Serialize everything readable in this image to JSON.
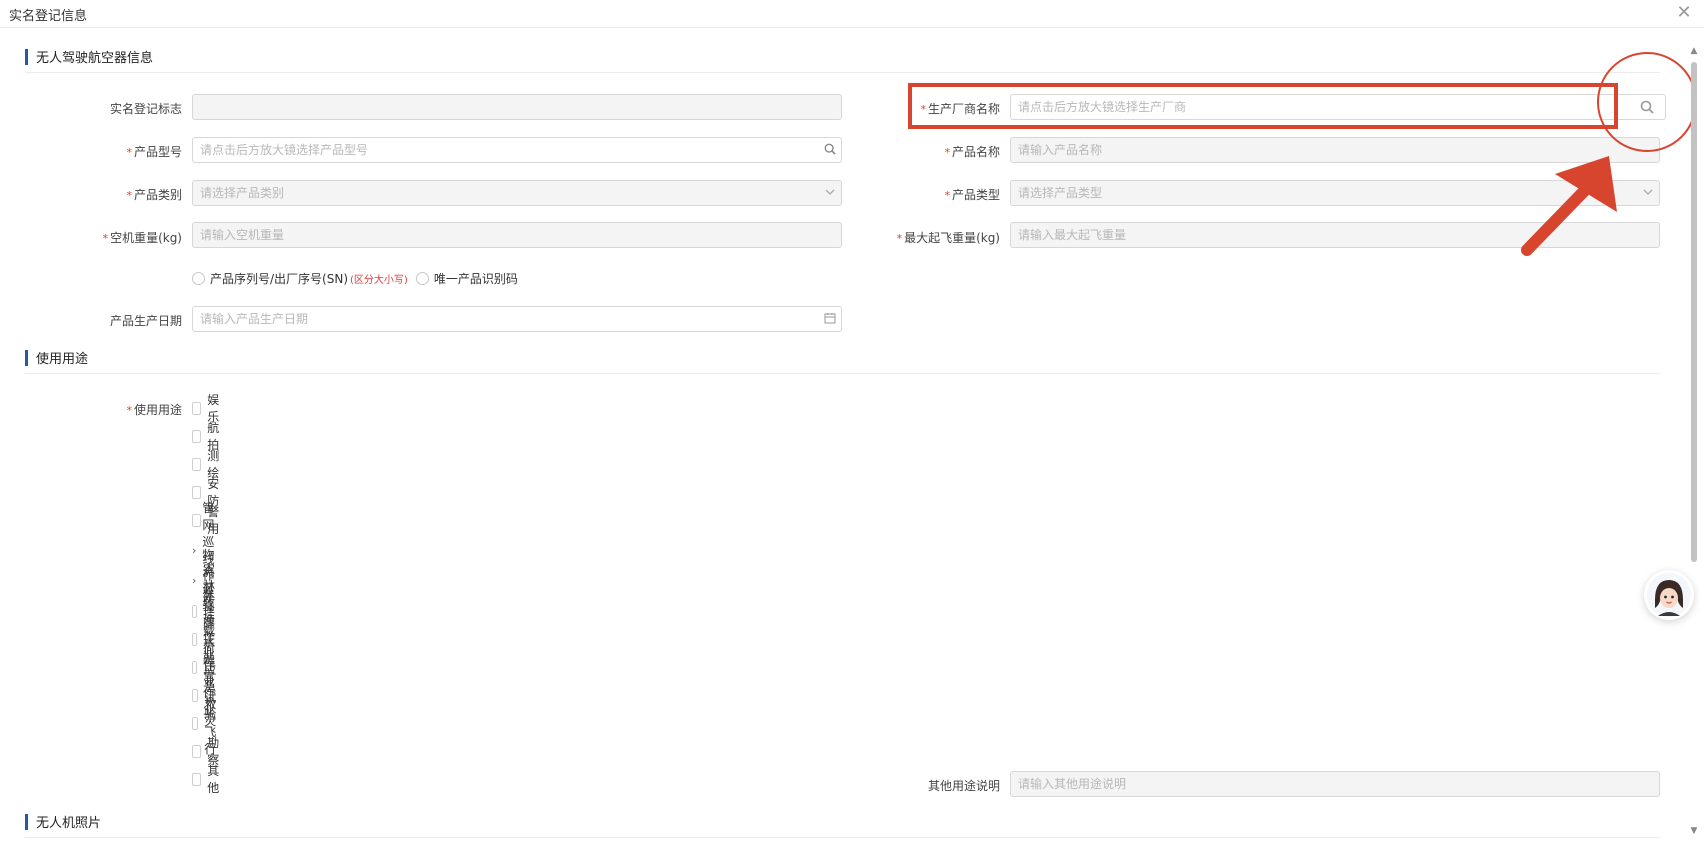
{
  "window": {
    "title": "实名登记信息"
  },
  "sections": {
    "aircraft": "无人驾驶航空器信息",
    "usage": "使用用途",
    "photos": "无人机照片"
  },
  "form": {
    "reg_mark": {
      "label": "实名登记标志",
      "placeholder": ""
    },
    "manufacturer": {
      "label": "生产厂商名称",
      "placeholder": "请点击后方放大镜选择生产厂商"
    },
    "model": {
      "label": "产品型号",
      "placeholder": "请点击后方放大镜选择产品型号"
    },
    "product_name": {
      "label": "产品名称",
      "placeholder": "请输入产品名称"
    },
    "category": {
      "label": "产品类别",
      "placeholder": "请选择产品类别"
    },
    "product_type": {
      "label": "产品类型",
      "placeholder": "请选择产品类型"
    },
    "empty_weight": {
      "label": "空机重量(kg)",
      "placeholder": "请输入空机重量"
    },
    "max_takeoff": {
      "label": "最大起飞重量(kg)",
      "placeholder": "请输入最大起飞重量"
    },
    "serial_option": {
      "label": "产品序列号/出厂序号(SN)",
      "note": "(区分大小写)"
    },
    "uid_option": {
      "label": "唯一产品识别码"
    },
    "production_date": {
      "label": "产品生产日期",
      "placeholder": "请输入产品生产日期"
    }
  },
  "usage": {
    "label": "使用用途",
    "items": [
      {
        "type": "checkbox",
        "label": "娱乐"
      },
      {
        "type": "checkbox",
        "label": "航拍"
      },
      {
        "type": "checkbox",
        "label": "测绘"
      },
      {
        "type": "checkbox",
        "label": "安防"
      },
      {
        "type": "checkbox",
        "label": "警用"
      },
      {
        "type": "group",
        "label": "管网巡线作业"
      },
      {
        "type": "group",
        "label": "物流运输"
      },
      {
        "type": "checkbox",
        "label": "农林牧渔作业"
      },
      {
        "type": "checkbox",
        "label": "外挂载荷作业"
      },
      {
        "type": "checkbox",
        "label": "降水融雪作业"
      },
      {
        "type": "checkbox",
        "label": "应急救灾"
      },
      {
        "type": "checkbox",
        "label": "试验飞行"
      },
      {
        "type": "checkbox",
        "label": "勘察"
      },
      {
        "type": "checkbox",
        "label": "其他"
      }
    ],
    "other_desc": {
      "label": "其他用途说明",
      "placeholder": "请输入其他用途说明"
    }
  },
  "colors": {
    "accent": "#1e5ba8",
    "annotation": "#d8452f",
    "required": "#e03b3b"
  }
}
